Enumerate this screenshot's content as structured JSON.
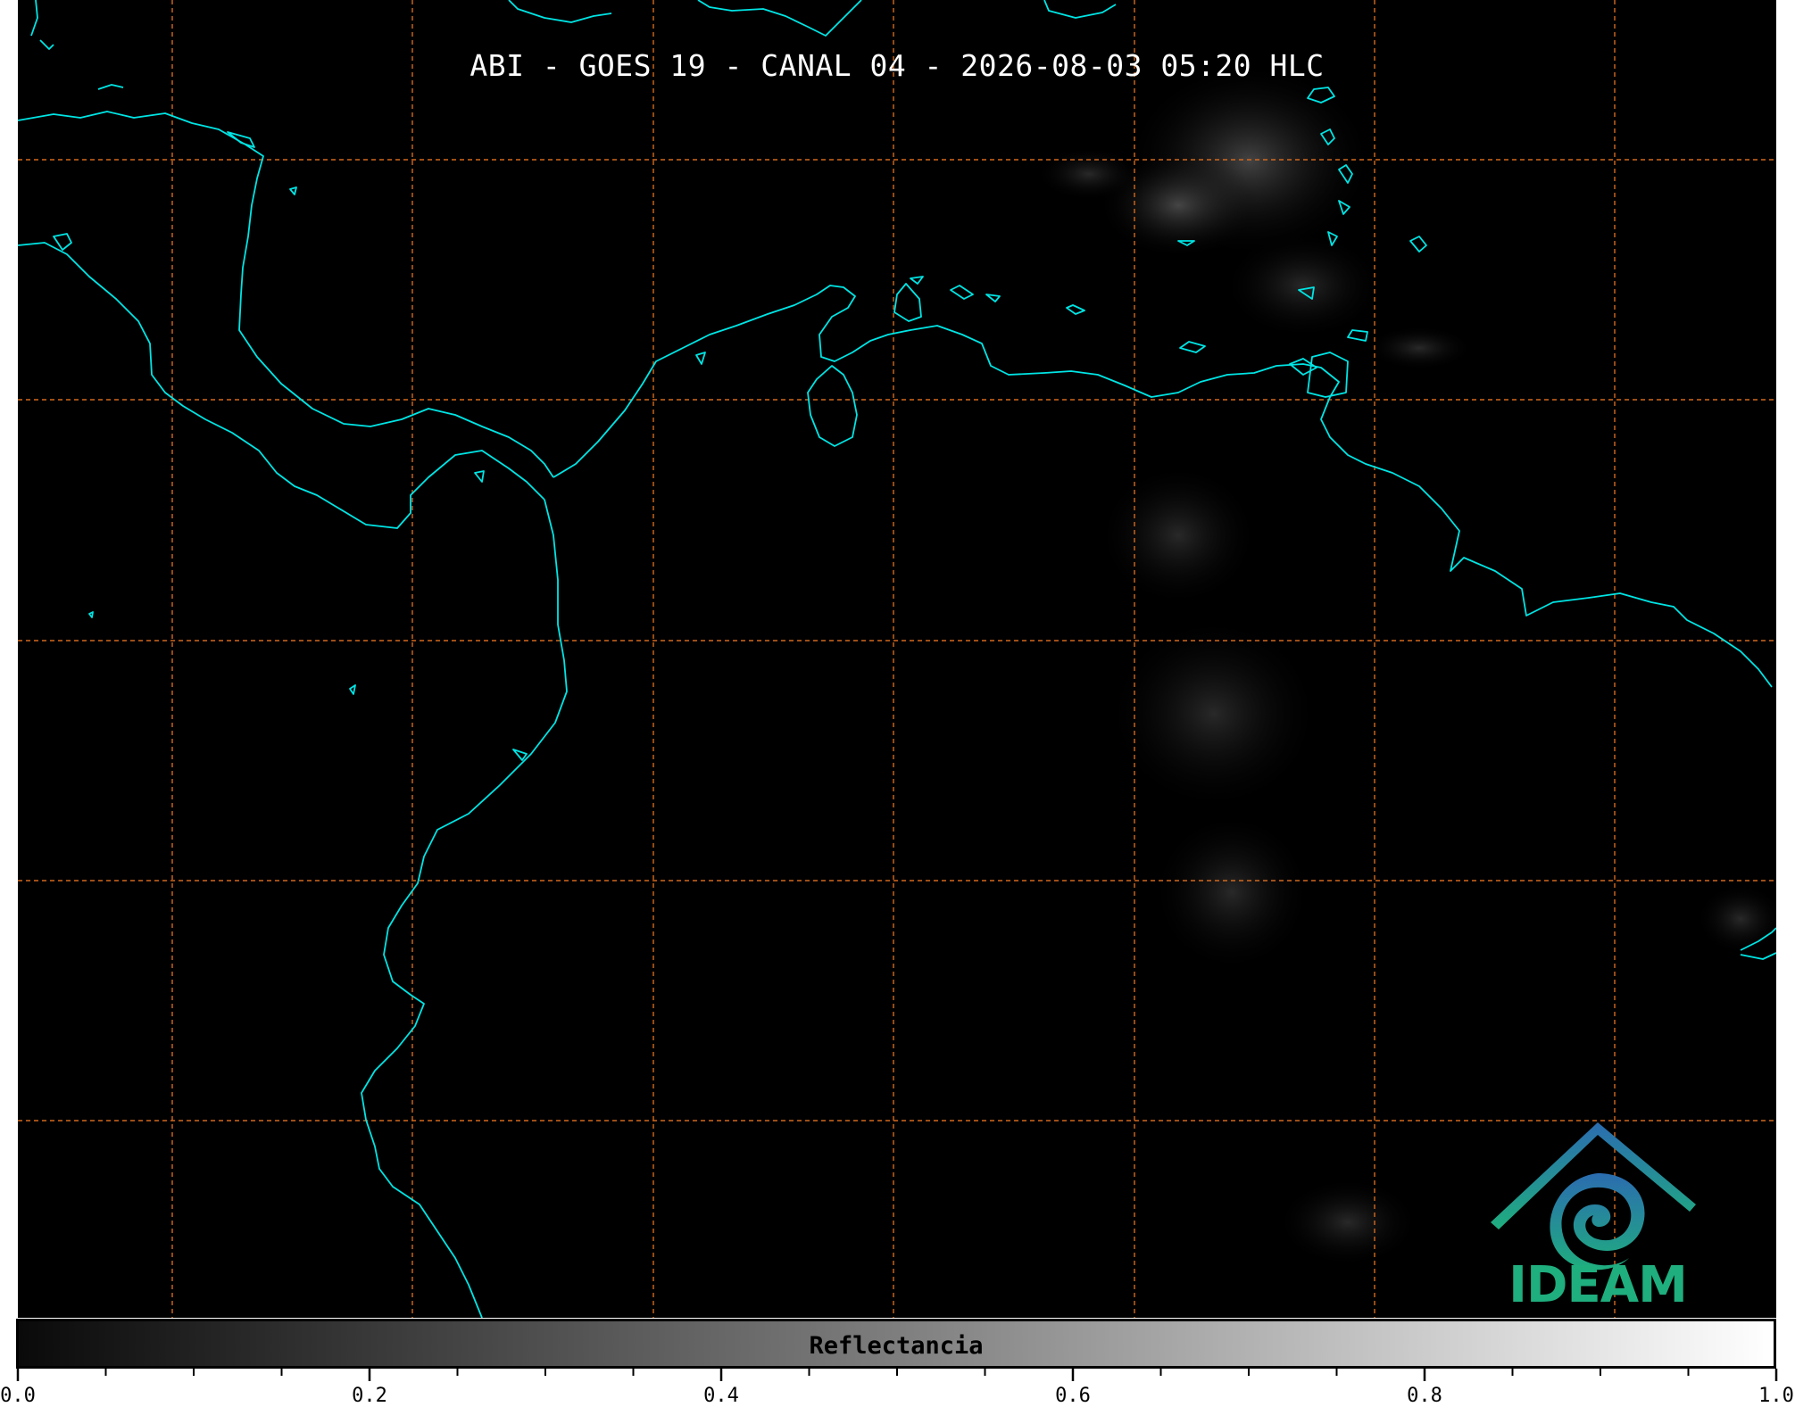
{
  "title": "ABI - GOES 19 - CANAL 04 - 2026-08-03 05:20 HLC",
  "map": {
    "background_color": "#000000",
    "coastline_color": "#00e5e5",
    "grid_color": "#d2691e",
    "grid_style": "dashed"
  },
  "logo": {
    "text": "IDEAM",
    "icon": "ideam-logo-icon",
    "colors": [
      "#2b6cb0",
      "#1fae7e"
    ]
  },
  "colorbar": {
    "label": "Reflectancia",
    "min": 0.0,
    "max": 1.0,
    "colormap": "grayscale",
    "tick_labels": [
      "0.0",
      "0.2",
      "0.4",
      "0.6",
      "0.8",
      "1.0"
    ]
  }
}
